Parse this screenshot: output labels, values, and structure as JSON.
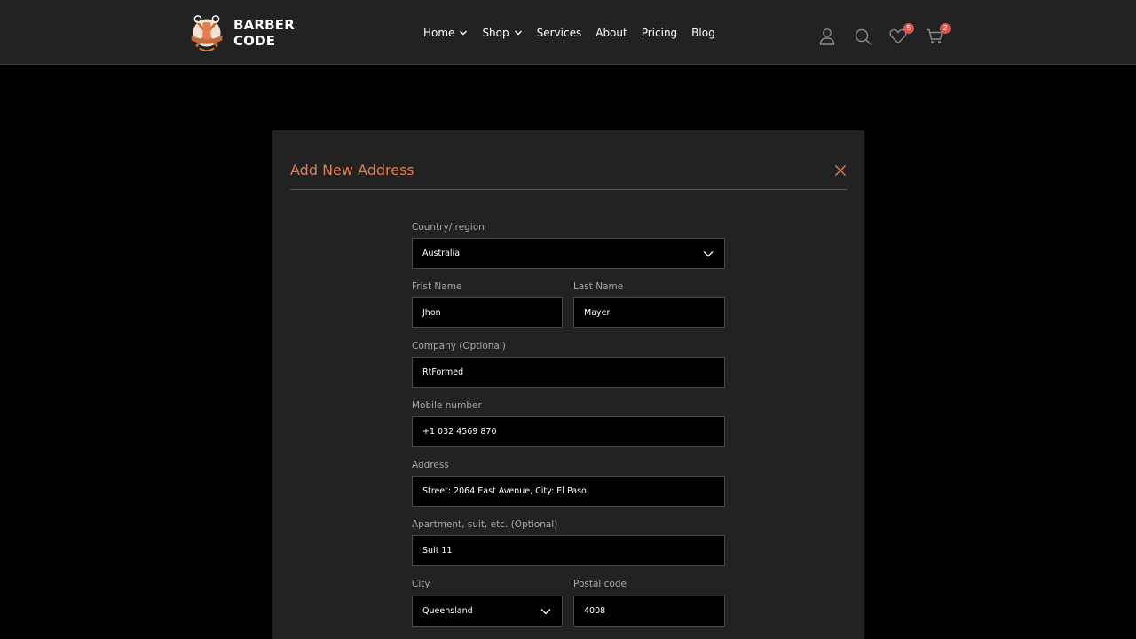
{
  "brand": {
    "line1": "BARBER",
    "line2": "CODE"
  },
  "nav": {
    "items": [
      {
        "label": "Home",
        "dropdown": true
      },
      {
        "label": "Shop",
        "dropdown": true
      },
      {
        "label": "Services",
        "dropdown": false
      },
      {
        "label": "About",
        "dropdown": false
      },
      {
        "label": "Pricing",
        "dropdown": false
      },
      {
        "label": "Blog",
        "dropdown": false
      }
    ]
  },
  "header_icons": {
    "account": "user-icon",
    "search": "search-icon",
    "wishlist": {
      "icon": "heart-icon",
      "count": "5"
    },
    "cart": {
      "icon": "cart-icon",
      "count": "2"
    }
  },
  "modal": {
    "title": "Add New Address",
    "fields": {
      "country": {
        "label": "Country/ region",
        "value": "Australia"
      },
      "first_name": {
        "label": "Frist Name",
        "value": "Jhon"
      },
      "last_name": {
        "label": "Last Name",
        "value": "Mayer"
      },
      "company": {
        "label": "Company (Optional)",
        "value": "RtFormed"
      },
      "mobile": {
        "label": "Mobile number",
        "value": "+1 032 4569 870"
      },
      "address": {
        "label": "Address",
        "value": "Street: 2064 East Avenue, City: El Paso"
      },
      "apartment": {
        "label": "Apartment, suit, etc. (Optional)",
        "value": "Suit 11"
      },
      "city": {
        "label": "City",
        "value": "Queensland"
      },
      "postal": {
        "label": "Postal code",
        "value": "4008"
      }
    }
  },
  "colors": {
    "accent": "#e57c53",
    "badge": "#e0524d",
    "header_bg": "#222222",
    "page_bg": "#000000"
  }
}
